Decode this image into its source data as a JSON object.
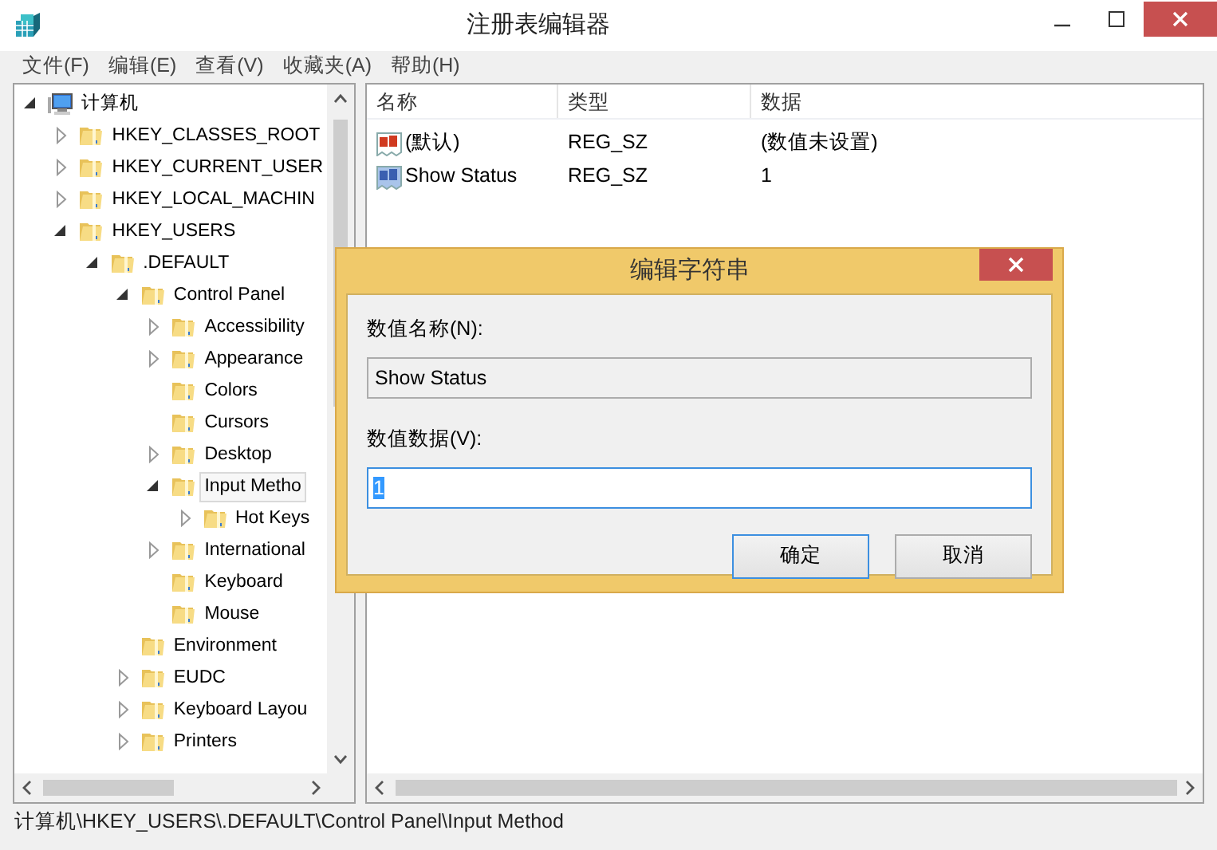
{
  "window": {
    "title": "注册表编辑器"
  },
  "menu": [
    "文件(F)",
    "编辑(E)",
    "查看(V)",
    "收藏夹(A)",
    "帮助(H)"
  ],
  "tree": [
    {
      "label": "计算机",
      "kind": "computer",
      "expanded": true,
      "selected": false,
      "children": [
        {
          "label": "HKEY_CLASSES_ROOT",
          "kind": "folder",
          "expanded": false,
          "selected": false
        },
        {
          "label": "HKEY_CURRENT_USER",
          "kind": "folder",
          "expanded": false,
          "selected": false
        },
        {
          "label": "HKEY_LOCAL_MACHIN",
          "kind": "folder",
          "expanded": false,
          "selected": false
        },
        {
          "label": "HKEY_USERS",
          "kind": "folder",
          "expanded": true,
          "selected": false,
          "children": [
            {
              "label": ".DEFAULT",
              "kind": "folder",
              "expanded": true,
              "selected": false,
              "children": [
                {
                  "label": "Control Panel",
                  "kind": "folder",
                  "expanded": true,
                  "selected": false,
                  "children": [
                    {
                      "label": "Accessibility",
                      "kind": "folder",
                      "expanded": false,
                      "selected": false
                    },
                    {
                      "label": "Appearance",
                      "kind": "folder",
                      "expanded": false,
                      "selected": false
                    },
                    {
                      "label": "Colors",
                      "kind": "leaf",
                      "selected": false
                    },
                    {
                      "label": "Cursors",
                      "kind": "leaf",
                      "selected": false
                    },
                    {
                      "label": "Desktop",
                      "kind": "folder",
                      "expanded": false,
                      "selected": false
                    },
                    {
                      "label": "Input Metho",
                      "kind": "folder",
                      "expanded": true,
                      "selected": true,
                      "children": [
                        {
                          "label": "Hot Keys",
                          "kind": "folder",
                          "expanded": false,
                          "selected": false
                        }
                      ]
                    },
                    {
                      "label": "International",
                      "kind": "folder",
                      "expanded": false,
                      "selected": false
                    },
                    {
                      "label": "Keyboard",
                      "kind": "leaf",
                      "selected": false
                    },
                    {
                      "label": "Mouse",
                      "kind": "leaf",
                      "selected": false
                    }
                  ]
                },
                {
                  "label": "Environment",
                  "kind": "leaf",
                  "selected": false
                },
                {
                  "label": "EUDC",
                  "kind": "folder",
                  "expanded": false,
                  "selected": false
                },
                {
                  "label": "Keyboard Layou",
                  "kind": "folder",
                  "expanded": false,
                  "selected": false
                },
                {
                  "label": "Printers",
                  "kind": "folder",
                  "expanded": false,
                  "selected": false
                }
              ]
            }
          ]
        }
      ]
    }
  ],
  "table": {
    "columns": [
      "名称",
      "类型",
      "数据"
    ],
    "rows": [
      {
        "kind": "default",
        "cells": [
          "(默认)",
          "REG_SZ",
          "(数值未设置)"
        ]
      },
      {
        "kind": "string",
        "cells": [
          "Show Status",
          "REG_SZ",
          "1"
        ]
      }
    ]
  },
  "dialog": {
    "title": "编辑字符串",
    "name_label": "数值名称(N):",
    "name_value": "Show Status",
    "data_label": "数值数据(V):",
    "data_value": "1",
    "data_value_selected": true,
    "buttons": [
      {
        "label": "确定",
        "default": true
      },
      {
        "label": "取消",
        "default": false
      }
    ]
  },
  "status_bar": "计算机\\HKEY_USERS\\.DEFAULT\\Control Panel\\Input Method"
}
